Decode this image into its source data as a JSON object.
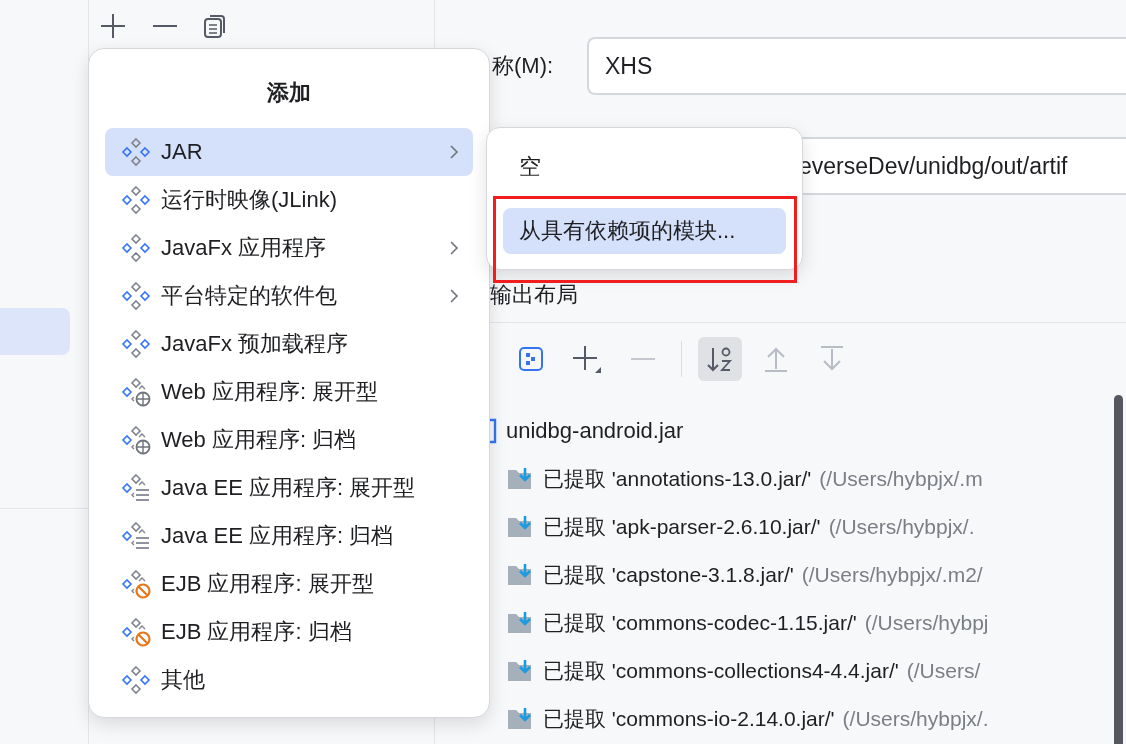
{
  "sidebar": {
    "items": [
      {
        "selected": true
      }
    ]
  },
  "form": {
    "name_label": "称(M):",
    "name_value": "XHS",
    "output_path": "everseDev/unidbg/out/artif"
  },
  "output_layout": {
    "title": "输出布局",
    "toolbar": [
      {
        "kind": "layout",
        "disabled": false,
        "on": false
      },
      {
        "kind": "add",
        "disabled": false,
        "on": false
      },
      {
        "kind": "remove",
        "disabled": true,
        "on": false
      },
      {
        "kind": "sort",
        "disabled": false,
        "on": true
      },
      {
        "kind": "up",
        "disabled": true,
        "on": false
      },
      {
        "kind": "down",
        "disabled": true,
        "on": false
      }
    ],
    "tree": {
      "root": "unidbg-android.jar",
      "children": [
        {
          "label": "已提取 'annotations-13.0.jar/'",
          "path": "(/Users/hybpjx/.m"
        },
        {
          "label": "已提取 'apk-parser-2.6.10.jar/'",
          "path": "(/Users/hybpjx/."
        },
        {
          "label": "已提取 'capstone-3.1.8.jar/'",
          "path": "(/Users/hybpjx/.m2/"
        },
        {
          "label": "已提取 'commons-codec-1.15.jar/'",
          "path": "(/Users/hybpj"
        },
        {
          "label": "已提取 'commons-collections4-4.4.jar/'",
          "path": "(/Users/"
        },
        {
          "label": "已提取 'commons-io-2.14.0.jar/'",
          "path": "(/Users/hybpjx/."
        }
      ]
    }
  },
  "popup_menu": {
    "title": "添加",
    "items": [
      {
        "label": "JAR",
        "kind": "module",
        "has_submenu": true,
        "selected": true
      },
      {
        "label": "运行时映像(JLink)",
        "kind": "module",
        "has_submenu": false,
        "selected": false
      },
      {
        "label": "JavaFx 应用程序",
        "kind": "module",
        "has_submenu": true,
        "selected": false
      },
      {
        "label": "平台特定的软件包",
        "kind": "module",
        "has_submenu": true,
        "selected": false
      },
      {
        "label": "JavaFx 预加载程序",
        "kind": "module",
        "has_submenu": false,
        "selected": false
      },
      {
        "label": "Web 应用程序: 展开型",
        "kind": "web",
        "has_submenu": false,
        "selected": false
      },
      {
        "label": "Web 应用程序: 归档",
        "kind": "web",
        "has_submenu": false,
        "selected": false
      },
      {
        "label": "Java EE 应用程序: 展开型",
        "kind": "ee",
        "has_submenu": false,
        "selected": false
      },
      {
        "label": "Java EE 应用程序: 归档",
        "kind": "ee",
        "has_submenu": false,
        "selected": false
      },
      {
        "label": "EJB 应用程序: 展开型",
        "kind": "ejb",
        "has_submenu": false,
        "selected": false
      },
      {
        "label": "EJB 应用程序: 归档",
        "kind": "ejb",
        "has_submenu": false,
        "selected": false
      },
      {
        "label": "其他",
        "kind": "module",
        "has_submenu": false,
        "selected": false
      }
    ]
  },
  "submenu": {
    "items": [
      {
        "label": "空",
        "selected": false,
        "outlined": false
      },
      {
        "label": "从具有依赖项的模块...",
        "selected": true,
        "outlined": true
      }
    ]
  }
}
